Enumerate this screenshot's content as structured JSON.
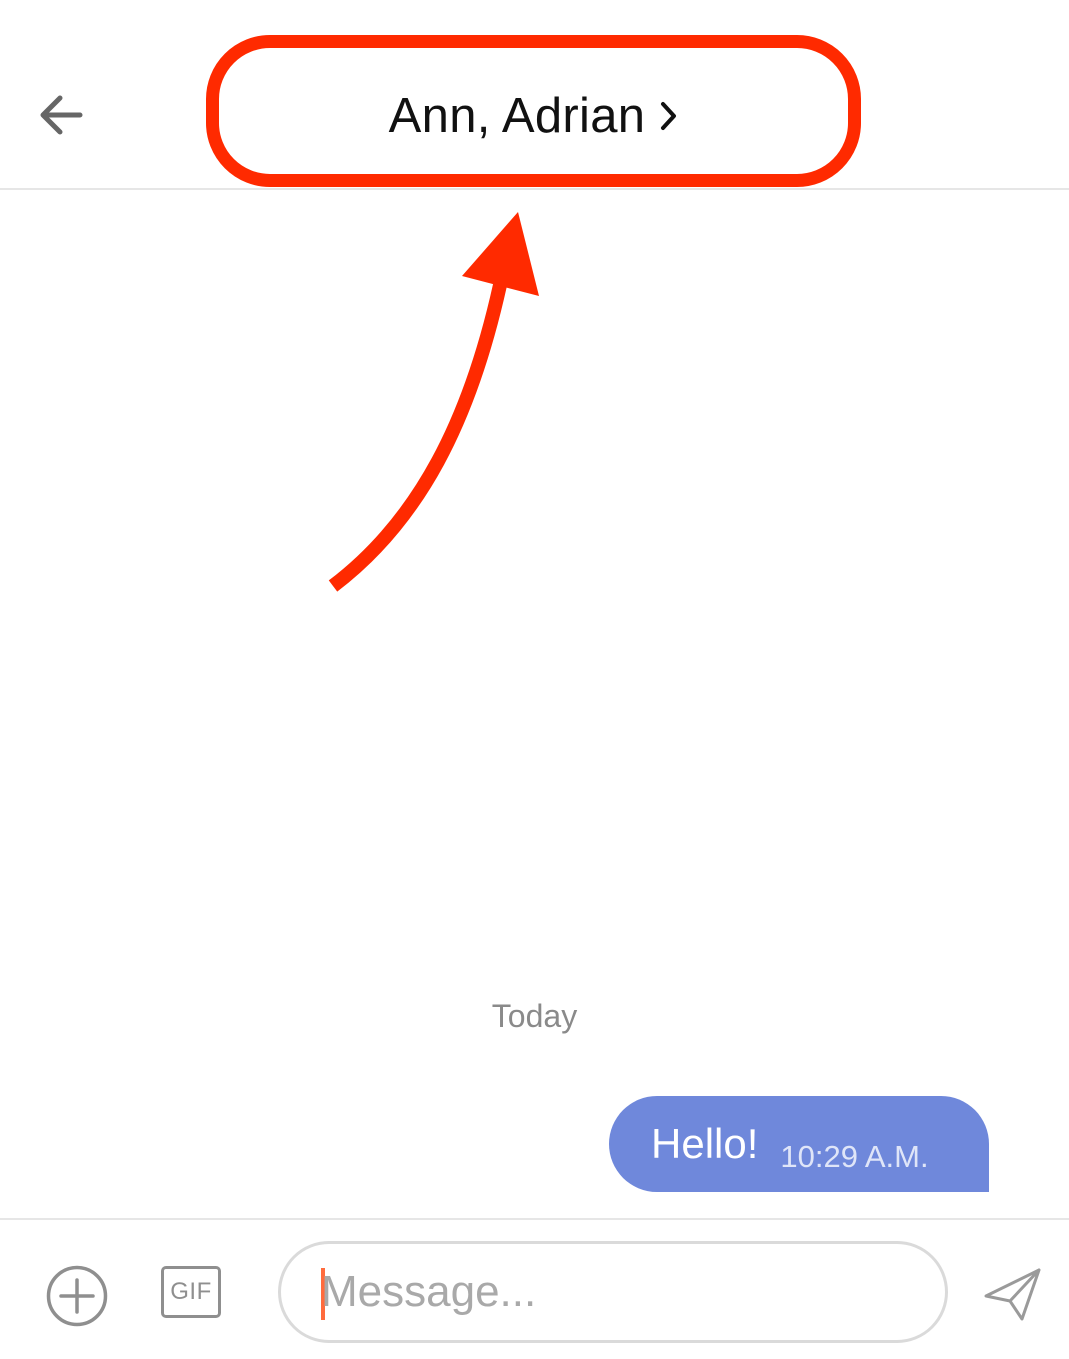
{
  "header": {
    "title": "Ann, Adrian",
    "back_icon": "arrow-left-icon",
    "title_chevron_icon": "chevron-right-icon"
  },
  "annotation": {
    "color": "#ff2a00"
  },
  "chat": {
    "day_separator": "Today",
    "messages": [
      {
        "text": "Hello!",
        "time": "10:29 A.M.",
        "direction": "outgoing",
        "bubble_color": "#6f88db"
      }
    ]
  },
  "composer": {
    "add_icon": "plus-circle-icon",
    "gif_label": "GIF",
    "placeholder": "Message...",
    "value": "",
    "send_icon": "paper-plane-icon",
    "caret_color": "#ff6b3d"
  }
}
